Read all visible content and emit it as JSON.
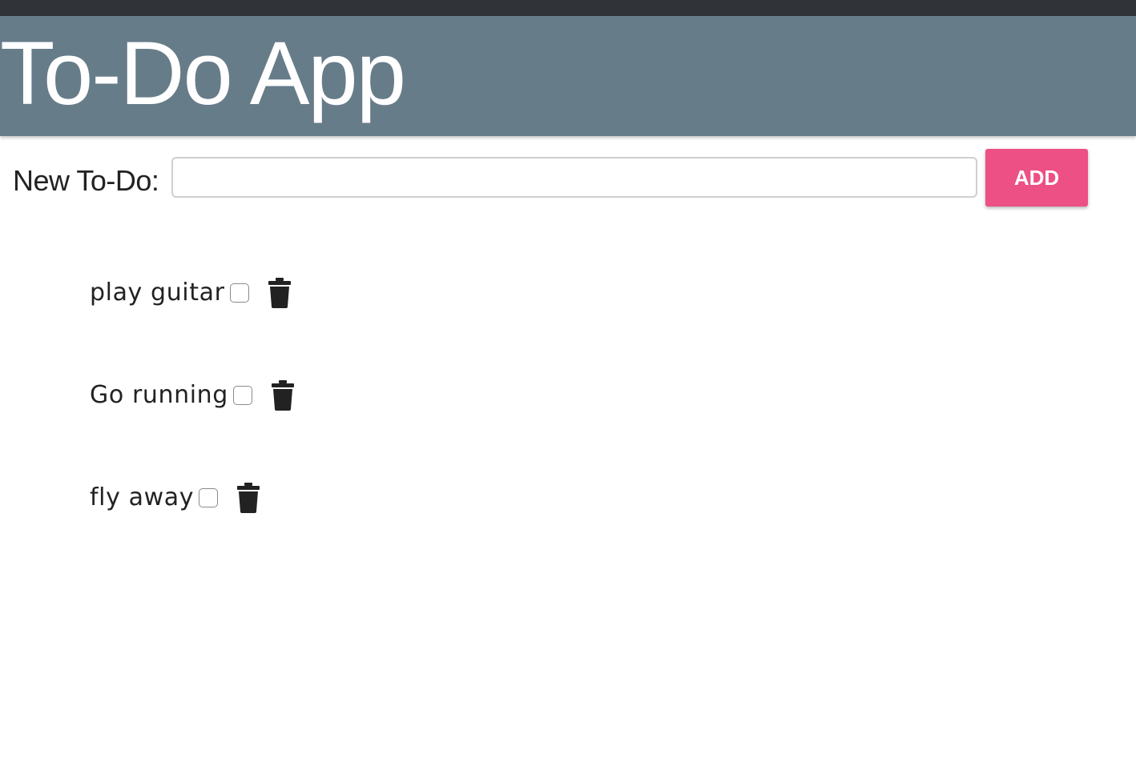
{
  "header": {
    "title": "To-Do App"
  },
  "form": {
    "label": "New To-Do:",
    "input_value": "",
    "add_label": "ADD"
  },
  "todos": [
    {
      "text": "play guitar",
      "done": false,
      "icon": "trash-icon"
    },
    {
      "text": "Go running",
      "done": false,
      "icon": "trash-icon"
    },
    {
      "text": "fly away",
      "done": false,
      "icon": "trash-icon"
    }
  ],
  "colors": {
    "topbar": "#303438",
    "header": "#677c89",
    "accent": "#ec5084"
  }
}
